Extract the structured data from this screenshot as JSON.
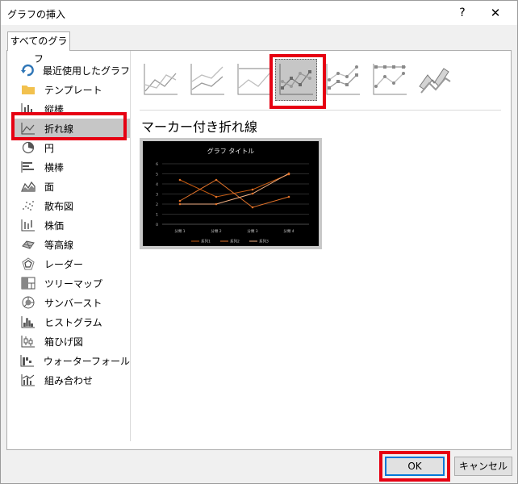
{
  "window": {
    "title": "グラフの挿入",
    "help": "?",
    "close": "✕"
  },
  "tabs": [
    {
      "label": "すべてのグラフ"
    }
  ],
  "sidebar": {
    "items": [
      {
        "label": "最近使用したグラフ",
        "icon": "recent-icon"
      },
      {
        "label": "テンプレート",
        "icon": "folder-icon"
      },
      {
        "label": "縦棒",
        "icon": "column-chart-icon"
      },
      {
        "label": "折れ線",
        "icon": "line-chart-icon",
        "selected": true
      },
      {
        "label": "円",
        "icon": "pie-chart-icon"
      },
      {
        "label": "横棒",
        "icon": "bar-chart-icon"
      },
      {
        "label": "面",
        "icon": "area-chart-icon"
      },
      {
        "label": "散布図",
        "icon": "scatter-chart-icon"
      },
      {
        "label": "株価",
        "icon": "stock-chart-icon"
      },
      {
        "label": "等高線",
        "icon": "surface-chart-icon"
      },
      {
        "label": "レーダー",
        "icon": "radar-chart-icon"
      },
      {
        "label": "ツリーマップ",
        "icon": "treemap-icon"
      },
      {
        "label": "サンバースト",
        "icon": "sunburst-icon"
      },
      {
        "label": "ヒストグラム",
        "icon": "histogram-icon"
      },
      {
        "label": "箱ひげ図",
        "icon": "boxwhisker-icon"
      },
      {
        "label": "ウォーターフォール",
        "icon": "waterfall-icon"
      },
      {
        "label": "組み合わせ",
        "icon": "combo-chart-icon"
      }
    ]
  },
  "subtypes": {
    "selected_index": 3,
    "selected_title": "マーカー付き折れ線"
  },
  "preview": {
    "title": "グラフ タイトル",
    "categories": [
      "分類 1",
      "分類 2",
      "分類 3",
      "分類 4"
    ],
    "yticks": [
      "0",
      "1",
      "2",
      "3",
      "4",
      "5",
      "6"
    ],
    "legend": [
      "系列1",
      "系列2",
      "系列3"
    ]
  },
  "buttons": {
    "ok": "OK",
    "cancel": "キャンセル"
  },
  "colors": {
    "highlight": "#e60012",
    "accent": "#0078d7",
    "series": "#e0722a"
  }
}
